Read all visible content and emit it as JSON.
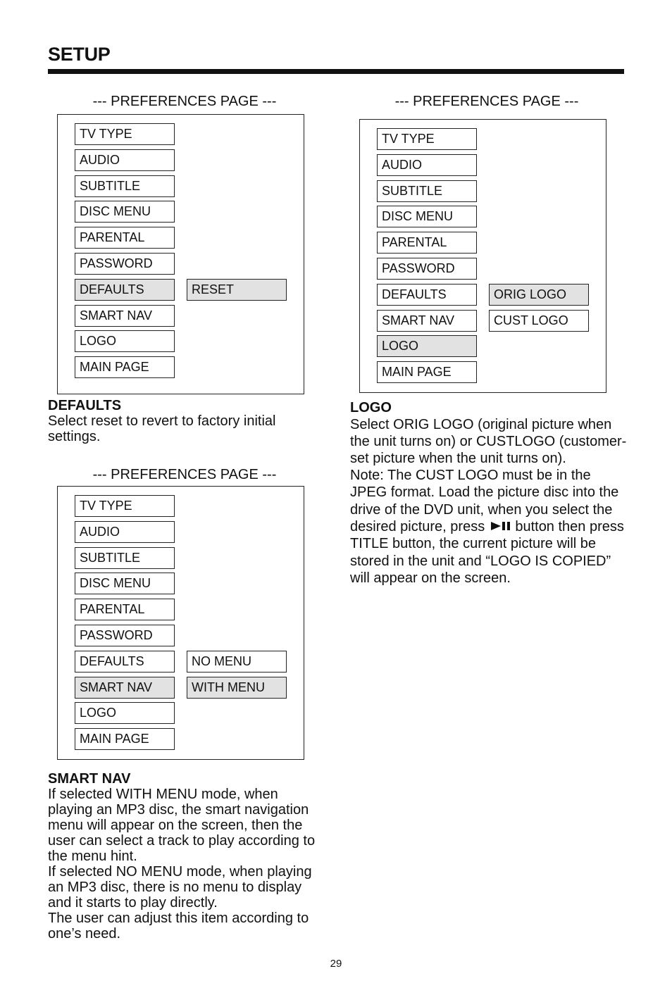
{
  "header": {
    "title": "SETUP"
  },
  "menu_items": [
    "TV TYPE",
    "AUDIO",
    "SUBTITLE",
    "DISC MENU",
    "PARENTAL",
    "PASSWORD",
    "DEFAULTS",
    "SMART NAV",
    "LOGO",
    "MAIN PAGE"
  ],
  "panels": {
    "defaults": {
      "heading": "--- PREFERENCES PAGE ---",
      "selected_item": "DEFAULTS",
      "options": [
        {
          "label": "RESET",
          "selected": true
        }
      ]
    },
    "smart_nav": {
      "heading": "--- PREFERENCES PAGE ---",
      "selected_item": "SMART NAV",
      "options": [
        {
          "label": "NO MENU",
          "selected": false
        },
        {
          "label": "WITH MENU",
          "selected": true
        }
      ]
    },
    "logo": {
      "heading": "--- PREFERENCES PAGE ---",
      "selected_item": "LOGO",
      "options": [
        {
          "label": "ORIG LOGO",
          "selected": true
        },
        {
          "label": "CUST LOGO",
          "selected": false
        }
      ]
    }
  },
  "sections": {
    "defaults": {
      "heading": "DEFAULTS",
      "body": "Select reset to revert to factory initial settings."
    },
    "smart_nav": {
      "heading": "SMART NAV",
      "body": "If selected WITH MENU mode, when playing an MP3 disc, the smart navigation menu will appear on the screen, then the user can select a track to play according to the menu hint.",
      "body2": "If selected NO MENU mode, when playing an MP3 disc, there is no menu to display and it starts to play directly.",
      "body3": "The user can adjust this item according to one’s need."
    },
    "logo": {
      "heading": "LOGO",
      "body": "Select ORIG LOGO (original picture when the unit turns on) or CUSTLOGO (customer-set picture when the unit turns on).",
      "note_before_icon": "Note: The CUST LOGO must be in the JPEG format. Load the picture disc into the drive of the DVD unit, when you select the desired picture, press",
      "icon": "play-pause-icon",
      "note_after_icon": "button then press TITLE button, the current picture will be stored in the unit and “LOGO IS COPIED” will appear on the screen."
    }
  },
  "footer": {
    "page_number": "29"
  },
  "colors": {
    "highlight": "#e2e2e2",
    "text": "#111111"
  }
}
